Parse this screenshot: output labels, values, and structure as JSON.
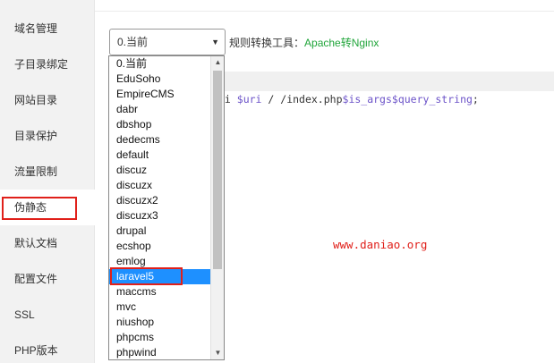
{
  "sidebar": {
    "items": [
      {
        "label": "域名管理"
      },
      {
        "label": "子目录绑定"
      },
      {
        "label": "网站目录"
      },
      {
        "label": "目录保护"
      },
      {
        "label": "流量限制"
      },
      {
        "label": "伪静态"
      },
      {
        "label": "默认文档"
      },
      {
        "label": "配置文件"
      },
      {
        "label": "SSL"
      },
      {
        "label": "PHP版本"
      }
    ],
    "active_index": 5
  },
  "rewrite": {
    "select_value": "0.当前",
    "tool_label": "规则转换工具：",
    "tool_link": "Apache转Nginx",
    "options": [
      "0.当前",
      "EduSoho",
      "EmpireCMS",
      "dabr",
      "dbshop",
      "dedecms",
      "default",
      "discuz",
      "discuzx",
      "discuzx2",
      "discuzx3",
      "drupal",
      "ecshop",
      "emlog",
      "laravel5",
      "maccms",
      "mvc",
      "niushop",
      "phpcms",
      "phpwind"
    ],
    "highlighted_option": "laravel5"
  },
  "editor": {
    "code_prefix": "ri ",
    "code_var1": "$uri",
    "code_mid": "/ /index.php",
    "code_var2": "$is_args$query_string",
    "code_suffix": ";"
  },
  "watermark": "www.daniao.org",
  "colors": {
    "accent_green": "#20a53a",
    "highlight_red": "#e0201a",
    "selected_blue": "#1e90ff"
  }
}
